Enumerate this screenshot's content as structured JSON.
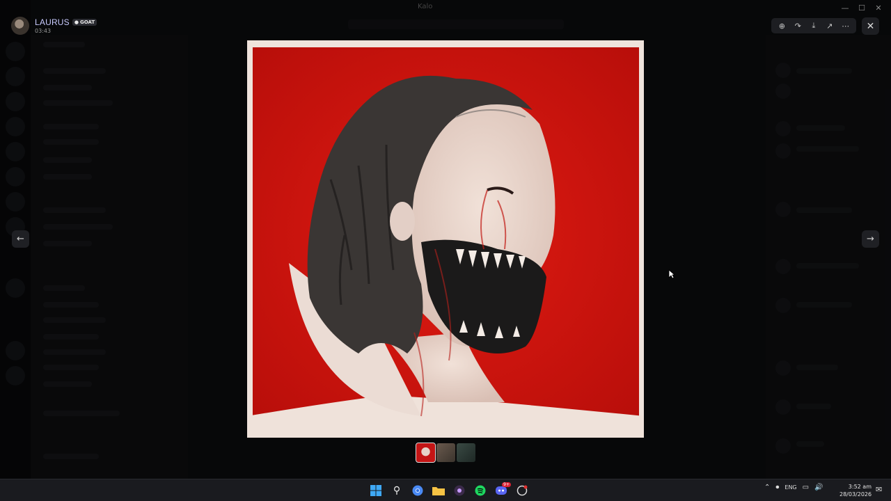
{
  "window": {
    "title": "Kalo"
  },
  "viewer": {
    "user_name": "LAURUS",
    "user_tag": "GOAT",
    "timestamp": "03:43",
    "tools": [
      "zoom-icon",
      "forward-icon",
      "download-icon",
      "open-external-icon",
      "more-icon"
    ],
    "close_icon": "close-icon"
  },
  "taskbar": {
    "apps": [
      "start-icon",
      "search-icon",
      "chrome-icon",
      "file-explorer-icon",
      "obs-icon",
      "spotify-icon",
      "discord-icon",
      "recorder-icon"
    ],
    "discord_badge": "9+",
    "language": "ENG",
    "time": "3:52 am",
    "date": "28/03/2026"
  }
}
